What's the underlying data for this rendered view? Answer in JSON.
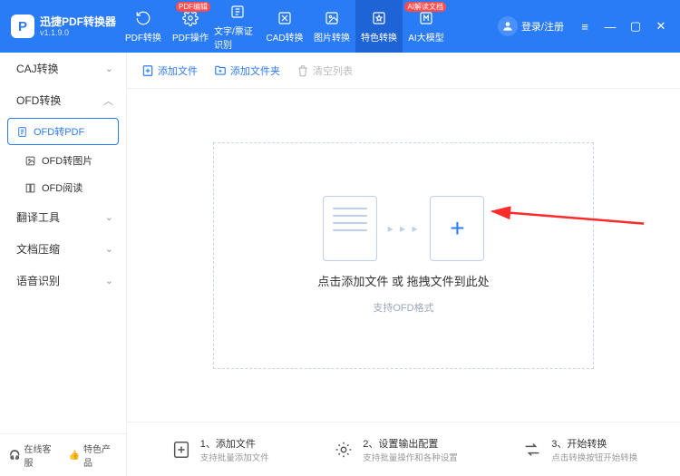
{
  "app": {
    "name": "迅捷PDF转换器",
    "version": "v1.1.9.0"
  },
  "header": {
    "tabs": [
      {
        "label": "PDF转换",
        "badge": ""
      },
      {
        "label": "PDF操作",
        "badge": "PDF编辑"
      },
      {
        "label": "文字/票证识别",
        "badge": ""
      },
      {
        "label": "CAD转换",
        "badge": ""
      },
      {
        "label": "图片转换",
        "badge": ""
      },
      {
        "label": "特色转换",
        "badge": ""
      },
      {
        "label": "AI大模型",
        "badge": "AI解读文档"
      }
    ],
    "login_label": "登录/注册"
  },
  "sidebar": {
    "groups": [
      {
        "head": "CAJ转换",
        "chev": "⌄",
        "open": false
      },
      {
        "head": "OFD转换",
        "chev": "︿",
        "open": true,
        "items": [
          {
            "label": "OFD转PDF",
            "active": true,
            "icon": "doc"
          },
          {
            "label": "OFD转图片",
            "active": false,
            "icon": "image"
          },
          {
            "label": "OFD阅读",
            "active": false,
            "icon": "book"
          }
        ]
      },
      {
        "head": "翻译工具",
        "chev": "⌄"
      },
      {
        "head": "文档压缩",
        "chev": "⌄"
      },
      {
        "head": "语音识别",
        "chev": "⌄"
      }
    ],
    "footer": {
      "support": "在线客服",
      "featured": "特色产品"
    }
  },
  "toolbar": {
    "add_file": "添加文件",
    "add_folder": "添加文件夹",
    "clear": "清空列表"
  },
  "dropzone": {
    "text": "点击添加文件 或 拖拽文件到此处",
    "sub": "支持OFD格式"
  },
  "steps": [
    {
      "title": "1、添加文件",
      "desc": "支持批量添加文件"
    },
    {
      "title": "2、设置输出配置",
      "desc": "支持批量操作和各种设置"
    },
    {
      "title": "3、开始转换",
      "desc": "点击转换按钮开始转换"
    }
  ]
}
